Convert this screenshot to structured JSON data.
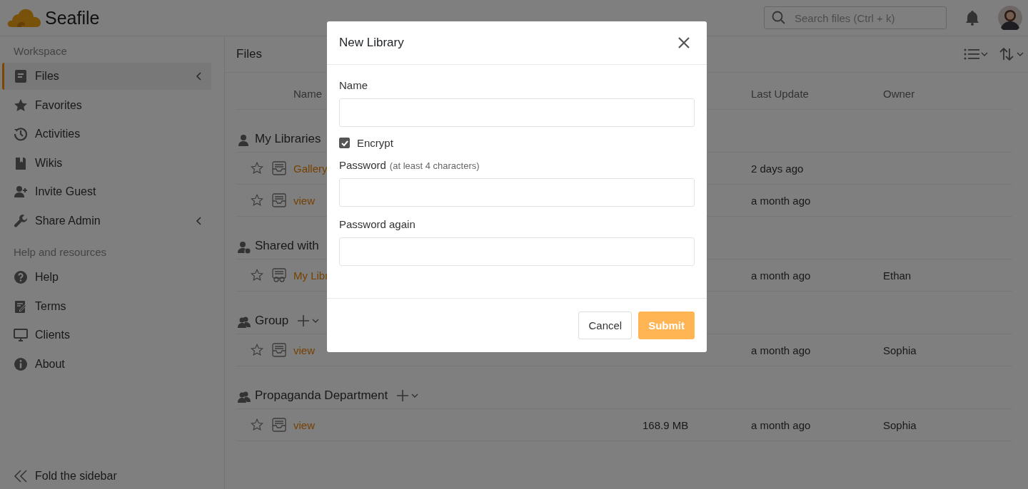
{
  "header": {
    "logo_text": "Seafile",
    "search": {
      "placeholder": "Search files (Ctrl + k)"
    }
  },
  "sidebar": {
    "sections": [
      {
        "title": "Workspace",
        "items": [
          {
            "label": "Files",
            "selected": true,
            "has_submenu": true
          },
          {
            "label": "Favorites",
            "selected": false,
            "has_submenu": false
          },
          {
            "label": "Activities",
            "selected": false,
            "has_submenu": false
          },
          {
            "label": "Wikis",
            "selected": false,
            "has_submenu": false
          },
          {
            "label": "Invite Guest",
            "selected": false,
            "has_submenu": false
          },
          {
            "label": "Share Admin",
            "selected": false,
            "has_submenu": true
          }
        ]
      },
      {
        "title": "Help and resources",
        "items": [
          {
            "label": "Help",
            "selected": false,
            "has_submenu": false
          },
          {
            "label": "Terms",
            "selected": false,
            "has_submenu": false
          },
          {
            "label": "Clients",
            "selected": false,
            "has_submenu": false
          },
          {
            "label": "About",
            "selected": false,
            "has_submenu": false
          }
        ]
      }
    ],
    "fold_label": "Fold the sidebar"
  },
  "main": {
    "title": "Files",
    "columns": [
      "Name",
      "Last Update",
      "Owner"
    ],
    "groups": [
      {
        "kind": "mine",
        "title": "My Libraries",
        "rows": [
          {
            "kind": "library",
            "starred": false,
            "name": "Gallery",
            "last_update": "2 days ago"
          },
          {
            "kind": "library",
            "starred": false,
            "name": "view",
            "last_update": "a month ago"
          }
        ]
      },
      {
        "kind": "shared",
        "title": "Shared with",
        "rows": [
          {
            "kind": "shared",
            "starred": false,
            "name": "My Libr",
            "last_update": "a month ago",
            "owner": "Ethan"
          }
        ]
      },
      {
        "kind": "group",
        "title": "Group",
        "rows": [
          {
            "kind": "library",
            "starred": false,
            "name": "view",
            "last_update": "a month ago",
            "owner": "Sophia"
          }
        ]
      },
      {
        "kind": "group",
        "title": "Propaganda Department",
        "rows": [
          {
            "kind": "library",
            "starred": false,
            "name": "view",
            "size": "168.9 MB",
            "last_update": "a month ago",
            "owner": "Sophia"
          }
        ]
      }
    ]
  },
  "dialog": {
    "title": "New Library",
    "form": [
      {
        "kind": "field",
        "label": "Name"
      },
      {
        "kind": "checkbox",
        "label": "Encrypt",
        "checked": true
      },
      {
        "kind": "field",
        "label": "Password",
        "hint": "(at least 4 characters)"
      },
      {
        "kind": "field",
        "label": "Password again"
      }
    ],
    "buttons": [
      {
        "kind": "secondary",
        "label": "Cancel",
        "disabled": false
      },
      {
        "kind": "primary",
        "label": "Submit",
        "disabled": true
      }
    ]
  }
}
